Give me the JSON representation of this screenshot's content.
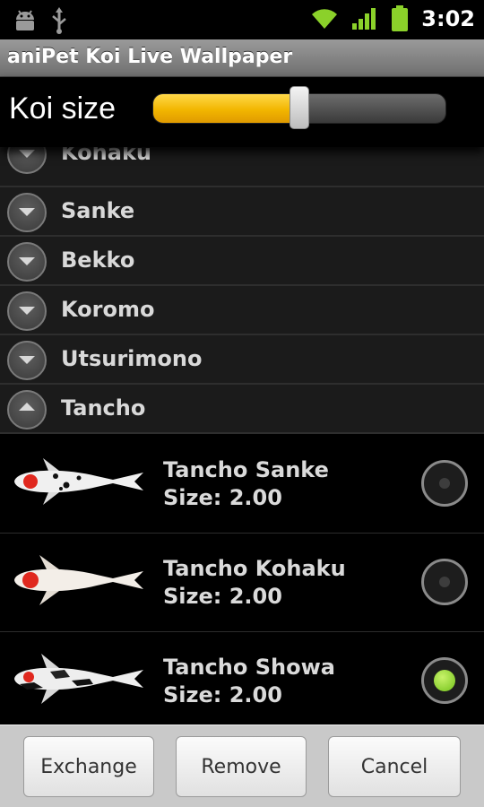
{
  "status_bar": {
    "time": "3:02",
    "left_icons": [
      "android-icon",
      "usb-icon"
    ],
    "right_icons": [
      "wifi-icon",
      "signal-icon",
      "battery-icon"
    ]
  },
  "title_bar": {
    "title": "aniPet Koi Live Wallpaper"
  },
  "size_setting": {
    "label": "Koi size",
    "slider_value_percent": 50,
    "slider_fill_color": "#f2b600"
  },
  "groups": [
    {
      "label": "Kohaku",
      "expanded": false
    },
    {
      "label": "Sanke",
      "expanded": false
    },
    {
      "label": "Bekko",
      "expanded": false
    },
    {
      "label": "Koromo",
      "expanded": false
    },
    {
      "label": "Utsurimono",
      "expanded": false
    },
    {
      "label": "Tancho",
      "expanded": true
    }
  ],
  "fish": [
    {
      "name": "Tancho Sanke",
      "size": "Size: 2.00",
      "selected": false
    },
    {
      "name": "Tancho Kohaku",
      "size": "Size: 2.00",
      "selected": false
    },
    {
      "name": "Tancho Showa",
      "size": "Size: 2.00",
      "selected": true
    }
  ],
  "buttons": {
    "exchange": "Exchange",
    "remove": "Remove",
    "cancel": "Cancel"
  },
  "colors": {
    "accent": "#f2b600",
    "radio_checked": "#72c21a"
  }
}
